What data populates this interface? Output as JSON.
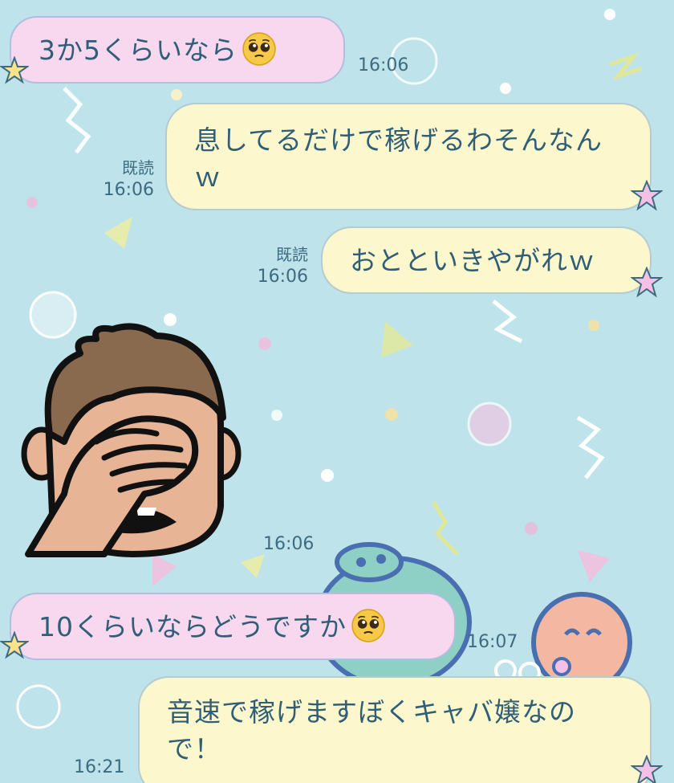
{
  "messages": [
    {
      "id": "m1",
      "side": "incoming",
      "text": "3か5くらいなら",
      "emoji": "pleading-face",
      "time": "16:06"
    },
    {
      "id": "m2",
      "side": "outgoing",
      "text": "息してるだけで稼げるわそんなんｗ",
      "read": "既読",
      "time": "16:06"
    },
    {
      "id": "m3",
      "side": "outgoing",
      "text": "おとといきやがれｗ",
      "read": "既読",
      "time": "16:06"
    },
    {
      "id": "m4",
      "side": "incoming",
      "type": "sticker",
      "sticker": "facepalm-man-sticker",
      "time": "16:06"
    },
    {
      "id": "m5",
      "side": "incoming",
      "text": "10くらいならどうですか",
      "emoji": "pleading-face",
      "time": "16:07"
    },
    {
      "id": "m6",
      "side": "outgoing",
      "text": "音速で稼げますぼくキャバ嬢なので！",
      "time": "16:21"
    }
  ],
  "colors": {
    "background": "#bfe3ea",
    "incoming_bubble": "#f7d8ef",
    "outgoing_bubble": "#fdf7cd",
    "text": "#2f5e76",
    "star": "#f4c0e6"
  }
}
